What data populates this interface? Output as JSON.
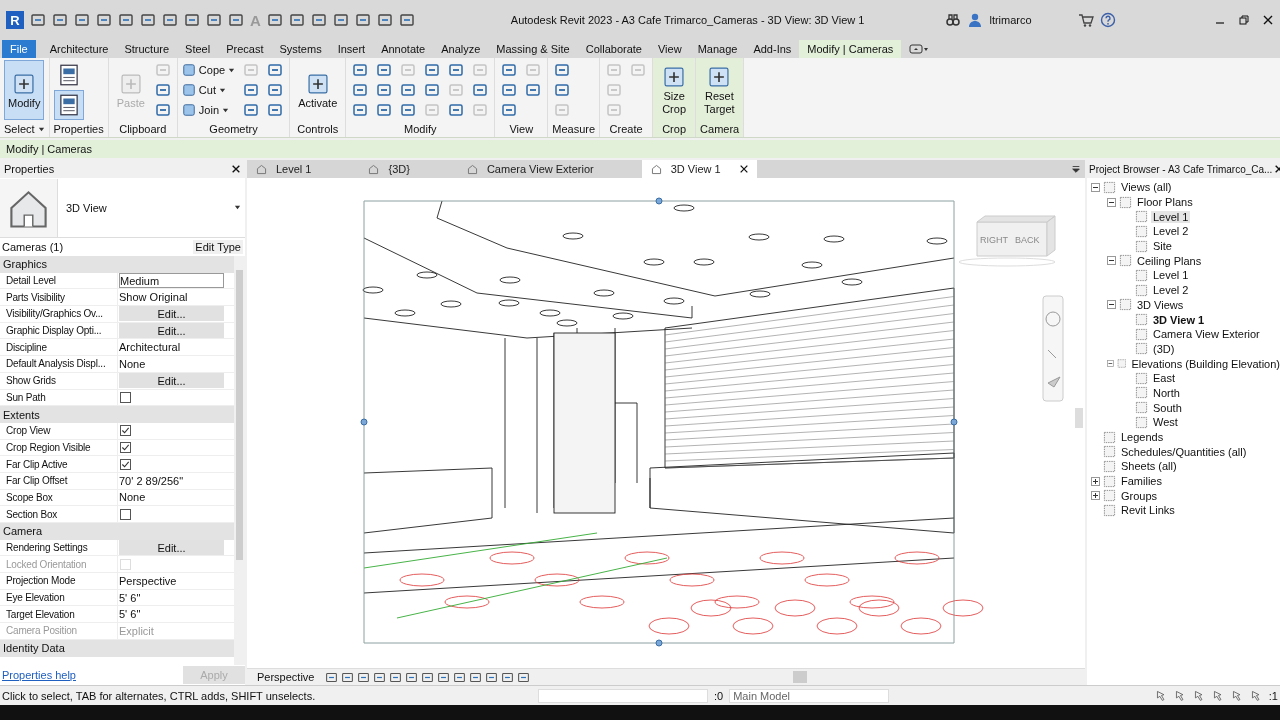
{
  "title_bar": {
    "logo": "R",
    "letter_tool": "A",
    "title": "Autodesk Revit 2023 - A3 Cafe Trimarco_Cameras - 3D View: 3D View 1",
    "user": "ltrimarco"
  },
  "ribbon_tabs": [
    {
      "label": "File",
      "selected": false,
      "kind": "file"
    },
    {
      "label": "Architecture",
      "selected": false,
      "kind": "tab"
    },
    {
      "label": "Structure",
      "selected": false,
      "kind": "tab"
    },
    {
      "label": "Steel",
      "selected": false,
      "kind": "tab"
    },
    {
      "label": "Precast",
      "selected": false,
      "kind": "tab"
    },
    {
      "label": "Systems",
      "selected": false,
      "kind": "tab"
    },
    {
      "label": "Insert",
      "selected": false,
      "kind": "tab"
    },
    {
      "label": "Annotate",
      "selected": false,
      "kind": "tab"
    },
    {
      "label": "Analyze",
      "selected": false,
      "kind": "tab"
    },
    {
      "label": "Massing & Site",
      "selected": false,
      "kind": "tab"
    },
    {
      "label": "Collaborate",
      "selected": false,
      "kind": "tab"
    },
    {
      "label": "View",
      "selected": false,
      "kind": "tab"
    },
    {
      "label": "Manage",
      "selected": false,
      "kind": "tab"
    },
    {
      "label": "Add-Ins",
      "selected": false,
      "kind": "tab"
    },
    {
      "label": "Modify | Cameras",
      "selected": true,
      "kind": "context"
    }
  ],
  "ribbon_panels": [
    {
      "title": "Select",
      "menu": true,
      "context": false,
      "tools": [
        {
          "kind": "large",
          "label": "Modify",
          "selected": true,
          "disabled": false
        }
      ]
    },
    {
      "title": "Properties",
      "menu": false,
      "context": false,
      "tools": [
        {
          "kind": "block",
          "selected": false
        },
        {
          "kind": "block",
          "selected": true
        }
      ]
    },
    {
      "title": "Clipboard",
      "menu": false,
      "context": false,
      "tools": [
        {
          "kind": "large",
          "label": "Paste",
          "selected": false,
          "disabled": true
        },
        {
          "kind": "icon",
          "disabled": true
        },
        {
          "kind": "icon",
          "disabled": false
        },
        {
          "kind": "icon",
          "disabled": false
        }
      ]
    },
    {
      "title": "Geometry",
      "menu": false,
      "context": false,
      "tools": [
        {
          "kind": "small",
          "label": "Cope",
          "disabled": false
        },
        {
          "kind": "small",
          "label": "Cut",
          "disabled": false
        },
        {
          "kind": "small",
          "label": "Join",
          "disabled": false
        },
        {
          "kind": "icon",
          "disabled": true
        },
        {
          "kind": "icon",
          "disabled": false
        },
        {
          "kind": "icon",
          "disabled": false
        },
        {
          "kind": "icon",
          "disabled": false
        },
        {
          "kind": "icon",
          "disabled": false
        },
        {
          "kind": "icon",
          "disabled": false
        }
      ]
    },
    {
      "title": "Controls",
      "menu": false,
      "context": false,
      "tools": [
        {
          "kind": "large",
          "label": "Activate",
          "selected": false,
          "disabled": false
        }
      ]
    },
    {
      "title": "Modify",
      "menu": false,
      "context": false,
      "tools": [
        {
          "kind": "icon",
          "disabled": false
        },
        {
          "kind": "icon",
          "disabled": false
        },
        {
          "kind": "icon",
          "disabled": false
        },
        {
          "kind": "icon",
          "disabled": false
        },
        {
          "kind": "icon",
          "disabled": false
        },
        {
          "kind": "icon",
          "disabled": false
        },
        {
          "kind": "icon",
          "disabled": true
        },
        {
          "kind": "icon",
          "disabled": false
        },
        {
          "kind": "icon",
          "disabled": false
        },
        {
          "kind": "icon",
          "disabled": false
        },
        {
          "kind": "icon",
          "disabled": false
        },
        {
          "kind": "icon",
          "disabled": true
        },
        {
          "kind": "icon",
          "disabled": false
        },
        {
          "kind": "icon",
          "disabled": true
        },
        {
          "kind": "icon",
          "disabled": false
        },
        {
          "kind": "icon",
          "disabled": true
        },
        {
          "kind": "icon",
          "disabled": false
        },
        {
          "kind": "icon",
          "disabled": true
        }
      ]
    },
    {
      "title": "View",
      "menu": false,
      "context": false,
      "tools": [
        {
          "kind": "icon",
          "disabled": false
        },
        {
          "kind": "icon",
          "disabled": false
        },
        {
          "kind": "icon",
          "disabled": false
        },
        {
          "kind": "icon",
          "disabled": true
        },
        {
          "kind": "icon",
          "disabled": false
        }
      ]
    },
    {
      "title": "Measure",
      "menu": false,
      "context": false,
      "tools": [
        {
          "kind": "icon",
          "disabled": false
        },
        {
          "kind": "icon",
          "disabled": false
        },
        {
          "kind": "icon",
          "disabled": true
        }
      ]
    },
    {
      "title": "Create",
      "menu": false,
      "context": false,
      "tools": [
        {
          "kind": "icon",
          "disabled": true
        },
        {
          "kind": "icon",
          "disabled": true
        },
        {
          "kind": "icon",
          "disabled": true
        },
        {
          "kind": "icon",
          "disabled": true
        }
      ]
    },
    {
      "title": "Crop",
      "menu": false,
      "context": true,
      "tools": [
        {
          "kind": "large",
          "label": "Size\nCrop",
          "selected": false,
          "disabled": false
        }
      ]
    },
    {
      "title": "Camera",
      "menu": false,
      "context": true,
      "tools": [
        {
          "kind": "large",
          "label": "Reset\nTarget",
          "selected": false,
          "disabled": false
        }
      ]
    }
  ],
  "options_bar": {
    "label": "Modify | Cameras"
  },
  "properties": {
    "title": "Properties",
    "type_name": "3D View",
    "filter": "Cameras (1)",
    "edit_type": "Edit Type",
    "sections": [
      {
        "title": "Graphics",
        "rows": [
          {
            "label": "Detail Level",
            "kind": "field",
            "value": "Medium",
            "disabled": false
          },
          {
            "label": "Parts Visibility",
            "kind": "text",
            "value": "Show Original",
            "disabled": false
          },
          {
            "label": "Visibility/Graphics Ov...",
            "kind": "button",
            "value": "Edit...",
            "disabled": false
          },
          {
            "label": "Graphic Display Opti...",
            "kind": "button",
            "value": "Edit...",
            "disabled": false
          },
          {
            "label": "Discipline",
            "kind": "text",
            "value": "Architectural",
            "disabled": false
          },
          {
            "label": "Default Analysis Displ...",
            "kind": "text",
            "value": "None",
            "disabled": false
          },
          {
            "label": "Show Grids",
            "kind": "button",
            "value": "Edit...",
            "disabled": false
          },
          {
            "label": "Sun Path",
            "kind": "checkbox",
            "checked": false,
            "disabled": false
          }
        ]
      },
      {
        "title": "Extents",
        "rows": [
          {
            "label": "Crop View",
            "kind": "checkbox",
            "checked": true,
            "disabled": false
          },
          {
            "label": "Crop Region Visible",
            "kind": "checkbox",
            "checked": true,
            "disabled": false
          },
          {
            "label": "Far Clip Active",
            "kind": "checkbox",
            "checked": true,
            "disabled": false
          },
          {
            "label": "Far Clip Offset",
            "kind": "text",
            "value": "70'  2 89/256\"",
            "disabled": false
          },
          {
            "label": "Scope Box",
            "kind": "text",
            "value": "None",
            "disabled": false
          },
          {
            "label": "Section Box",
            "kind": "checkbox",
            "checked": false,
            "disabled": false
          }
        ]
      },
      {
        "title": "Camera",
        "rows": [
          {
            "label": "Rendering Settings",
            "kind": "button",
            "value": "Edit...",
            "disabled": false
          },
          {
            "label": "Locked Orientation",
            "kind": "checkbox",
            "checked": false,
            "disabled": true
          },
          {
            "label": "Projection Mode",
            "kind": "text",
            "value": "Perspective",
            "disabled": false
          },
          {
            "label": "Eye Elevation",
            "kind": "text",
            "value": "5'  6\"",
            "disabled": false
          },
          {
            "label": "Target Elevation",
            "kind": "text",
            "value": "5'  6\"",
            "disabled": false
          },
          {
            "label": "Camera Position",
            "kind": "text",
            "value": "Explicit",
            "disabled": true
          }
        ]
      },
      {
        "title": "Identity Data"
      }
    ],
    "help_link": "Properties help",
    "apply": {
      "label": "Apply",
      "disabled": true
    }
  },
  "view_tabs": [
    {
      "label": "Level 1",
      "selected": false
    },
    {
      "label": "{3D}",
      "selected": false
    },
    {
      "label": "Camera View Exterior",
      "selected": false
    },
    {
      "label": "3D View 1",
      "selected": true
    }
  ],
  "view_cube": {
    "faces": [
      "RIGHT",
      "BACK"
    ]
  },
  "view_control_bar": {
    "label": "Perspective"
  },
  "project_browser": {
    "title": "Project Browser - A3 Cafe Trimarco_Ca...",
    "tree": [
      {
        "label": "Views (all)",
        "expanded": true,
        "selected": false,
        "current": false,
        "children": [
          {
            "label": "Floor Plans",
            "expanded": true,
            "selected": false,
            "current": false,
            "children": [
              {
                "label": "Level 1",
                "selected": true,
                "current": false
              },
              {
                "label": "Level 2",
                "selected": false,
                "current": false
              },
              {
                "label": "Site",
                "selected": false,
                "current": false
              }
            ]
          },
          {
            "label": "Ceiling Plans",
            "expanded": true,
            "selected": false,
            "current": false,
            "children": [
              {
                "label": "Level 1",
                "selected": false,
                "current": false
              },
              {
                "label": "Level 2",
                "selected": false,
                "current": false
              }
            ]
          },
          {
            "label": "3D Views",
            "expanded": true,
            "selected": false,
            "current": false,
            "children": [
              {
                "label": "3D View 1",
                "selected": false,
                "current": true
              },
              {
                "label": "Camera View Exterior",
                "selected": false,
                "current": false
              },
              {
                "label": "(3D)",
                "selected": false,
                "current": false
              }
            ]
          },
          {
            "label": "Elevations (Building Elevation)",
            "expanded": true,
            "selected": false,
            "current": false,
            "children": [
              {
                "label": "East",
                "selected": false,
                "current": false
              },
              {
                "label": "North",
                "selected": false,
                "current": false
              },
              {
                "label": "South",
                "selected": false,
                "current": false
              },
              {
                "label": "West",
                "selected": false,
                "current": false
              }
            ]
          }
        ]
      },
      {
        "label": "Legends",
        "selected": false,
        "current": false
      },
      {
        "label": "Schedules/Quantities (all)",
        "selected": false,
        "current": false
      },
      {
        "label": "Sheets (all)",
        "selected": false,
        "current": false
      },
      {
        "label": "Families",
        "expanded": false,
        "selected": false,
        "current": false
      },
      {
        "label": "Groups",
        "expanded": false,
        "selected": false,
        "current": false
      },
      {
        "label": "Revit Links",
        "selected": false,
        "current": false
      }
    ]
  },
  "status_bar": {
    "message": "Click to select, TAB for alternates, CTRL adds, SHIFT unselects.",
    "count": ":0",
    "model": "Main Model",
    "filter_count": ":1"
  }
}
